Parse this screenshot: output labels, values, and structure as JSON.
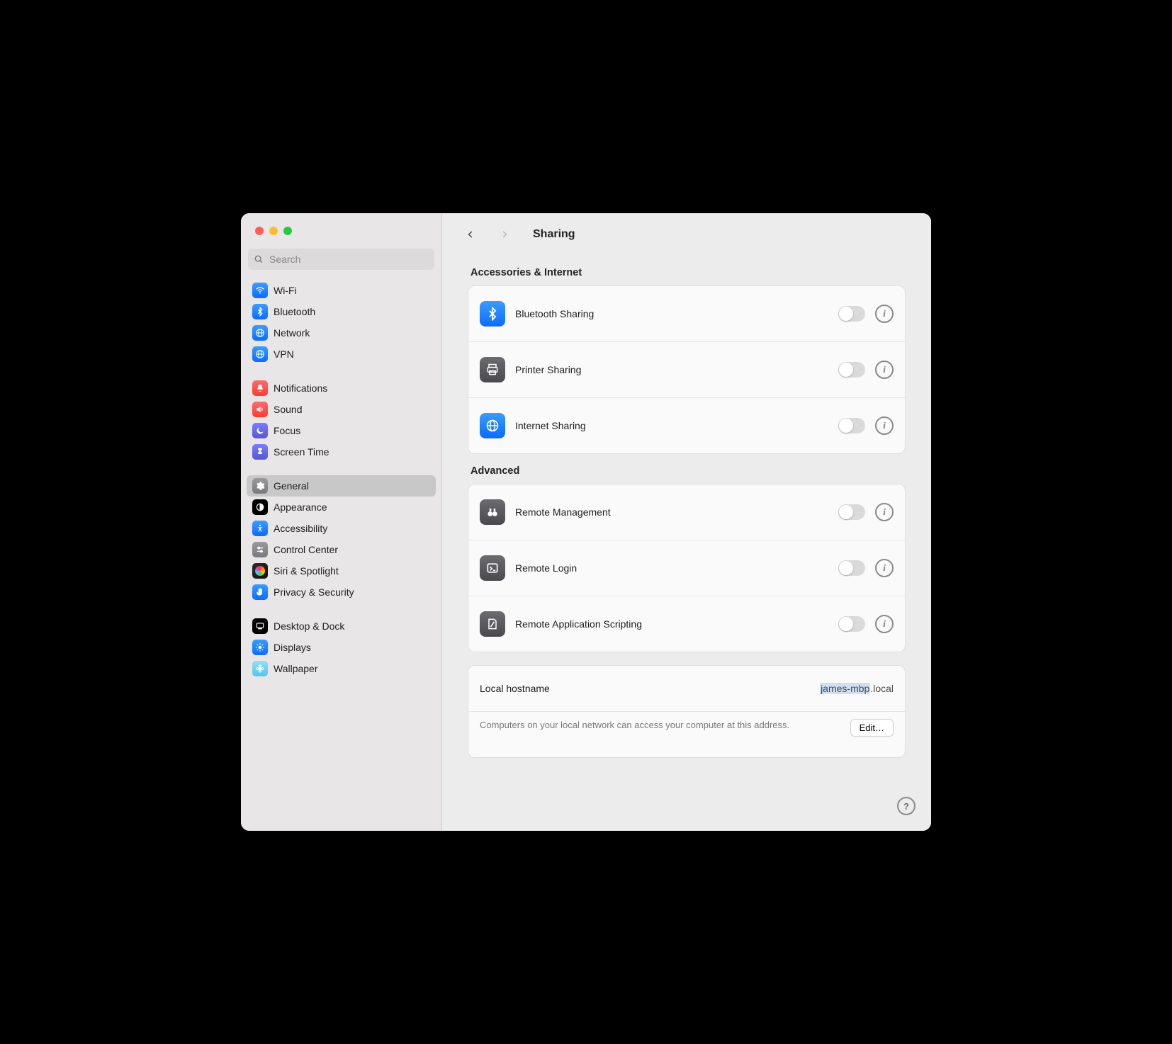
{
  "search": {
    "placeholder": "Search"
  },
  "header": {
    "title": "Sharing"
  },
  "sidebar": {
    "items": [
      {
        "label": "Wi-Fi"
      },
      {
        "label": "Bluetooth"
      },
      {
        "label": "Network"
      },
      {
        "label": "VPN"
      },
      {
        "label": "Notifications"
      },
      {
        "label": "Sound"
      },
      {
        "label": "Focus"
      },
      {
        "label": "Screen Time"
      },
      {
        "label": "General"
      },
      {
        "label": "Appearance"
      },
      {
        "label": "Accessibility"
      },
      {
        "label": "Control Center"
      },
      {
        "label": "Siri & Spotlight"
      },
      {
        "label": "Privacy & Security"
      },
      {
        "label": "Desktop & Dock"
      },
      {
        "label": "Displays"
      },
      {
        "label": "Wallpaper"
      }
    ]
  },
  "sections": {
    "accessories": {
      "title": "Accessories & Internet",
      "rows": [
        {
          "label": "Bluetooth Sharing"
        },
        {
          "label": "Printer Sharing"
        },
        {
          "label": "Internet Sharing"
        }
      ]
    },
    "advanced": {
      "title": "Advanced",
      "rows": [
        {
          "label": "Remote Management"
        },
        {
          "label": "Remote Login"
        },
        {
          "label": "Remote Application Scripting"
        }
      ]
    }
  },
  "hostname": {
    "title": "Local hostname",
    "name": "james-mbp",
    "suffix": ".local",
    "note": "Computers on your local network can access your computer at this address.",
    "edit": "Edit…"
  },
  "help": "?"
}
